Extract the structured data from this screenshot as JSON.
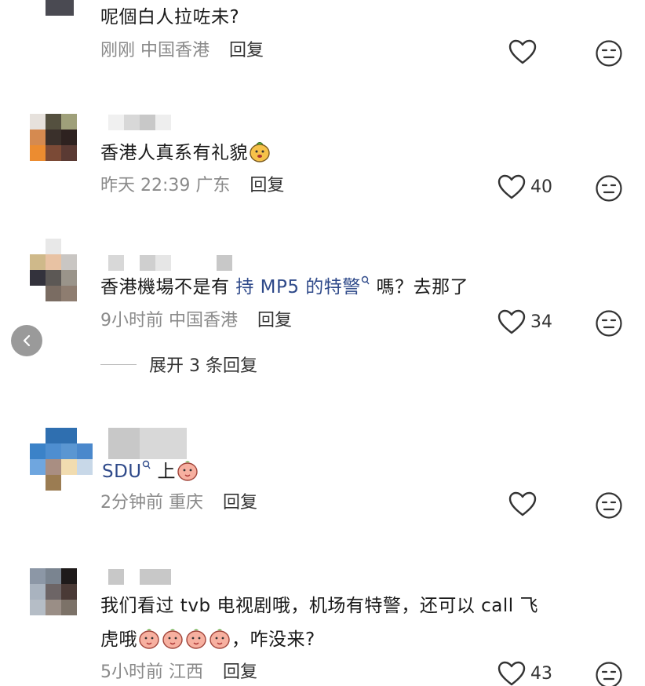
{
  "comments": [
    {
      "text": "呢個白人拉咗未?",
      "time": "刚刚",
      "location": "中国香港",
      "reply": "回复",
      "likes": ""
    },
    {
      "text": "香港人真系有礼貌",
      "time": "昨天 22:39",
      "location": "广东",
      "reply": "回复",
      "likes": "40"
    },
    {
      "text_before": "香港機場不是有 ",
      "link": "持 MP5 的特警",
      "text_after": " 嗎？去那了",
      "time": "9小时前",
      "location": "中国香港",
      "reply": "回复",
      "likes": "34",
      "expand": "展开 3 条回复"
    },
    {
      "text_before": "SDU",
      "text_after": " 上",
      "time": "2分钟前",
      "location": "重庆",
      "reply": "回复",
      "likes": ""
    },
    {
      "line1": "我们看过 tvb 电视剧哦，机场有特警，还可以 call 飞",
      "line2_before": "虎哦",
      "line2_after": "，咋没来?",
      "time": "5小时前",
      "location": "江西",
      "reply": "回复",
      "likes": "43"
    }
  ],
  "icons": {
    "like": "heart-outline-icon",
    "dislike": "neutral-face-icon",
    "back": "chevron-left-icon",
    "search_link": "search-link-icon"
  },
  "colors": {
    "link": "#2f4a8a",
    "meta": "#8a8a8a"
  }
}
